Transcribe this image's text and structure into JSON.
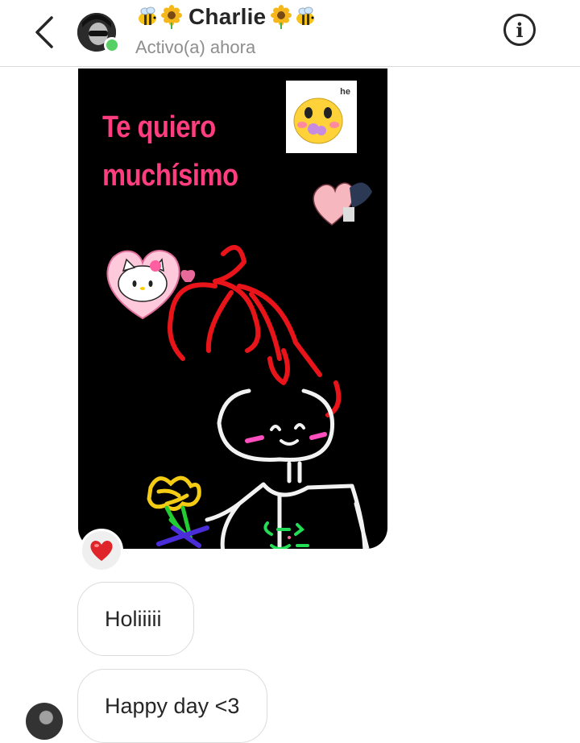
{
  "header": {
    "title": "Charlie",
    "title_prefix_emojis": [
      "bee-emoji",
      "sunflower-emoji"
    ],
    "title_suffix_emojis": [
      "sunflower-emoji",
      "bee-emoji"
    ],
    "status": "Activo(a) ahora",
    "online": true
  },
  "photo": {
    "line1": "Te quiero",
    "line2": "muchísimo",
    "sticker_label": "he"
  },
  "reaction": {
    "emoji": "heart"
  },
  "messages": [
    {
      "text": "Holiiiii"
    },
    {
      "text": "Happy day <3"
    }
  ],
  "colors": {
    "online": "#57d163",
    "photo_text": "#ff3d7f",
    "bubble_border": "#dbdbdb",
    "status_text": "#8e8e8e"
  }
}
